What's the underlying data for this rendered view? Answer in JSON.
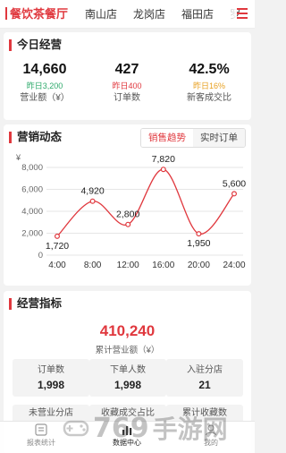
{
  "tabs": [
    {
      "label": "餐饮茶餐厅",
      "active": true
    },
    {
      "label": "南山店",
      "active": false
    },
    {
      "label": "龙岗店",
      "active": false
    },
    {
      "label": "福田店",
      "active": false
    },
    {
      "label": "罗",
      "active": false
    }
  ],
  "menu_icon": "hamburger-menu-icon",
  "accent_color": "#e0383e",
  "today": {
    "title": "今日经营",
    "kpis": [
      {
        "value": "14,660",
        "sub": "昨日3,200",
        "sub_color": "#2eaa6b",
        "label": "营业额（¥）"
      },
      {
        "value": "427",
        "sub": "昨日400",
        "sub_color": "#e0383e",
        "label": "订单数"
      },
      {
        "value": "42.5%",
        "sub": "昨日16%",
        "sub_color": "#e8a020",
        "label": "新客成交比"
      }
    ]
  },
  "marketing": {
    "title": "营销动态",
    "tabs": [
      {
        "label": "销售趋势",
        "active": true
      },
      {
        "label": "实时订单",
        "active": false
      }
    ]
  },
  "chart_data": {
    "type": "line",
    "x": [
      "4:00",
      "8:00",
      "12:00",
      "16:00",
      "20:00",
      "24:00"
    ],
    "series": [
      {
        "values": [
          1720,
          4920,
          2800,
          7820,
          1950,
          5600
        ]
      }
    ],
    "ylabel": "¥",
    "yticks": [
      "0",
      "2,000",
      "4,000",
      "6,000",
      "8,000"
    ],
    "ylim": [
      0,
      8000
    ],
    "data_labels": [
      "1,720",
      "4,920",
      "2,800",
      "7,820",
      "1,950",
      "5,600"
    ],
    "line_color": "#e0383e",
    "grid": true
  },
  "indicators": {
    "title": "经营指标",
    "total": "410,240",
    "total_label": "累计营业额（¥）",
    "items": [
      {
        "label": "订单数",
        "value": "1,998"
      },
      {
        "label": "下单人数",
        "value": "1,998"
      },
      {
        "label": "入驻分店",
        "value": "21"
      }
    ],
    "items_row2": [
      "未营业分店",
      "收藏成交占比",
      "累计收藏数"
    ]
  },
  "bottom_nav": [
    {
      "label": "报表统计",
      "icon": "report-icon",
      "active": false
    },
    {
      "label": "数据中心",
      "icon": "data-center-icon",
      "active": true
    },
    {
      "label": "我的",
      "icon": "profile-icon",
      "active": false
    }
  ],
  "watermark": {
    "num": "769",
    "text": "手游网"
  }
}
